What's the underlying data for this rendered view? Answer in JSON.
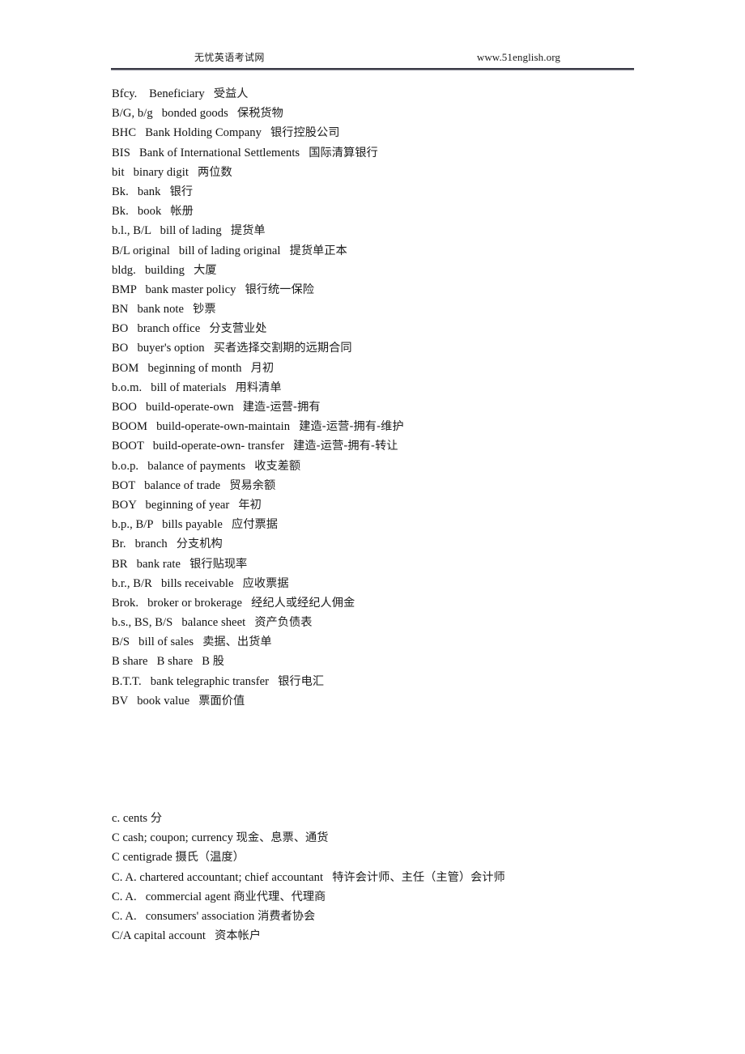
{
  "header": {
    "site_name": "无忧英语考试网",
    "site_url": "www.51english.org"
  },
  "sections": [
    {
      "id": "section-b",
      "entries": [
        {
          "abbr": "Bfcy.",
          "term": "Beneficiary",
          "zh": "受益人",
          "raw": "Bfcy.    Beneficiary   受益人"
        },
        {
          "abbr": "B/G, b/g",
          "term": "bonded goods",
          "zh": "保税货物",
          "raw": "B/G, b/g   bonded goods   保税货物"
        },
        {
          "abbr": "BHC",
          "term": "Bank Holding Company",
          "zh": "银行控股公司",
          "raw": "BHC   Bank Holding Company   银行控股公司"
        },
        {
          "abbr": "BIS",
          "term": "Bank of International Settlements",
          "zh": "国际清算银行",
          "raw": "BIS   Bank of International Settlements   国际清算银行"
        },
        {
          "abbr": "bit",
          "term": "binary digit",
          "zh": "两位数",
          "raw": "bit   binary digit   两位数"
        },
        {
          "abbr": "Bk.",
          "term": "bank",
          "zh": "银行",
          "raw": "Bk.   bank   银行"
        },
        {
          "abbr": "Bk.",
          "term": "book",
          "zh": "帐册",
          "raw": "Bk.   book   帐册"
        },
        {
          "abbr": "b.l., B/L",
          "term": "bill of lading",
          "zh": "提货单",
          "raw": "b.l., B/L   bill of lading   提货单"
        },
        {
          "abbr": "B/L original",
          "term": "bill of lading original",
          "zh": "提货单正本",
          "raw": "B/L original   bill of lading original   提货单正本"
        },
        {
          "abbr": "bldg.",
          "term": "building",
          "zh": "大厦",
          "raw": "bldg.   building   大厦"
        },
        {
          "abbr": "BMP",
          "term": "bank master policy",
          "zh": "银行统一保险",
          "raw": "BMP   bank master policy   银行统一保险"
        },
        {
          "abbr": "BN",
          "term": "bank note",
          "zh": "钞票",
          "raw": "BN   bank note   钞票"
        },
        {
          "abbr": "BO",
          "term": "branch office",
          "zh": "分支营业处",
          "raw": "BO   branch office   分支营业处"
        },
        {
          "abbr": "BO",
          "term": "buyer's option",
          "zh": "买者选择交割期的远期合同",
          "raw": "BO   buyer's option   买者选择交割期的远期合同"
        },
        {
          "abbr": "BOM",
          "term": "beginning of month",
          "zh": "月初",
          "raw": "BOM   beginning of month   月初"
        },
        {
          "abbr": "b.o.m.",
          "term": "bill of materials",
          "zh": "用料清单",
          "raw": "b.o.m.   bill of materials   用料清单"
        },
        {
          "abbr": "BOO",
          "term": "build-operate-own",
          "zh": "建造-运营-拥有",
          "raw": "BOO   build-operate-own   建造-运营-拥有"
        },
        {
          "abbr": "BOOM",
          "term": "build-operate-own-maintain",
          "zh": "建造-运营-拥有-维护",
          "raw": "BOOM   build-operate-own-maintain   建造-运营-拥有-维护"
        },
        {
          "abbr": "BOOT",
          "term": "build-operate-own- transfer",
          "zh": "建造-运营-拥有-转让",
          "raw": "BOOT   build-operate-own- transfer   建造-运营-拥有-转让"
        },
        {
          "abbr": "b.o.p.",
          "term": "balance of payments",
          "zh": "收支差额",
          "raw": "b.o.p.   balance of payments   收支差额"
        },
        {
          "abbr": "BOT",
          "term": "balance of trade",
          "zh": "贸易余额",
          "raw": "BOT   balance of trade   贸易余额"
        },
        {
          "abbr": "BOY",
          "term": "beginning of year",
          "zh": "年初",
          "raw": "BOY   beginning of year   年初"
        },
        {
          "abbr": "b.p., B/P",
          "term": "bills payable",
          "zh": "应付票据",
          "raw": "b.p., B/P   bills payable   应付票据"
        },
        {
          "abbr": "Br.",
          "term": "branch",
          "zh": "分支机构",
          "raw": "Br.   branch   分支机构"
        },
        {
          "abbr": "BR",
          "term": "bank rate",
          "zh": "银行贴现率",
          "raw": "BR   bank rate   银行贴现率"
        },
        {
          "abbr": "b.r., B/R",
          "term": "bills receivable",
          "zh": "应收票据",
          "raw": "b.r., B/R   bills receivable   应收票据"
        },
        {
          "abbr": "Brok.",
          "term": "broker or brokerage",
          "zh": "经纪人或经纪人佣金",
          "raw": "Brok.   broker or brokerage   经纪人或经纪人佣金"
        },
        {
          "abbr": "b.s., BS, B/S",
          "term": "balance sheet",
          "zh": "资产负债表",
          "raw": "b.s., BS, B/S   balance sheet   资产负债表"
        },
        {
          "abbr": "B/S",
          "term": "bill of sales",
          "zh": "卖据、出货单",
          "raw": "B/S   bill of sales   卖据、出货单"
        },
        {
          "abbr": "B share",
          "term": "B share",
          "zh": "B 股",
          "raw": "B share   B share   B 股"
        },
        {
          "abbr": "B.T.T.",
          "term": "bank telegraphic transfer",
          "zh": "银行电汇",
          "raw": "B.T.T.   bank telegraphic transfer   银行电汇"
        },
        {
          "abbr": "BV",
          "term": "book value",
          "zh": "票面价值",
          "raw": "BV   book value   票面价值"
        }
      ]
    },
    {
      "id": "section-c",
      "entries": [
        {
          "abbr": "c.",
          "term": "cents",
          "zh": "分",
          "raw": "c. cents 分"
        },
        {
          "abbr": "C",
          "term": "cash; coupon; currency",
          "zh": "现金、息票、通货",
          "raw": "C cash; coupon; currency 现金、息票、通货"
        },
        {
          "abbr": "C",
          "term": "centigrade",
          "zh": "摄氏（温度）",
          "raw": "C centigrade 摄氏（温度）"
        },
        {
          "abbr": "C. A.",
          "term": "chartered accountant; chief accountant",
          "zh": "特许会计师、主任（主管）会计师",
          "raw": "C. A. chartered accountant; chief accountant   特许会计师、主任（主管）会计师"
        },
        {
          "abbr": "C. A.",
          "term": "commercial agent",
          "zh": "商业代理、代理商",
          "raw": "C. A.   commercial agent 商业代理、代理商"
        },
        {
          "abbr": "C. A.",
          "term": "consumers' association",
          "zh": "消费者协会",
          "raw": "C. A.   consumers' association 消费者协会"
        },
        {
          "abbr": "C/A",
          "term": "capital account",
          "zh": "资本帐户",
          "raw": "C/A capital account   资本帐户"
        }
      ]
    }
  ]
}
